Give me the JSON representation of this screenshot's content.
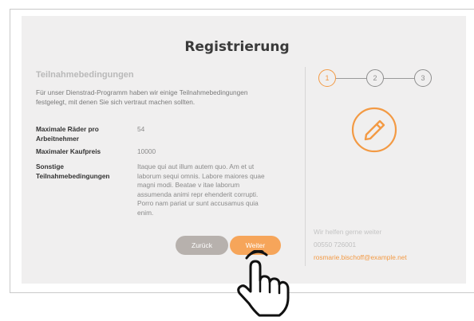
{
  "form": {
    "title": "Registrierung",
    "section_title": "Teilnahmebedingungen",
    "intro": "Für unser Dienstrad-Programm haben wir einige Teilnahmebedingungen festgelegt, mit denen Sie sich vertraut machen sollten.",
    "conditions": [
      {
        "label": "Maximale Räder pro Arbeitnehmer",
        "value": "54"
      },
      {
        "label": "Maximaler Kaufpreis",
        "value": "10000"
      },
      {
        "label": "Sonstige Teilnahmebedingungen",
        "value": "Itaque qui aut illum autem quo. Am et ut laborum sequi omnis. Labore maiores quae magni modi. Beatae v itae laborum assumenda animi repr ehenderit corrupti. Porro nam pariat ur sunt accusamus quia enim."
      }
    ],
    "back_label": "Zurück",
    "next_label": "Weiter"
  },
  "stepper": {
    "steps": [
      "1",
      "2",
      "3"
    ],
    "active_step": 1
  },
  "help": {
    "heading": "Wir helfen gerne weiter",
    "phone": "00550 726001",
    "email": "rosmarie.bischoff@example.net"
  },
  "icons": {
    "step_icon": "pencil-icon",
    "cursor": "hand-pointer-icon"
  },
  "colors": {
    "accent": "#f39a44",
    "next_button": "#f6a55a",
    "back_button": "#b7b1ad",
    "card_background": "#f0efef"
  }
}
